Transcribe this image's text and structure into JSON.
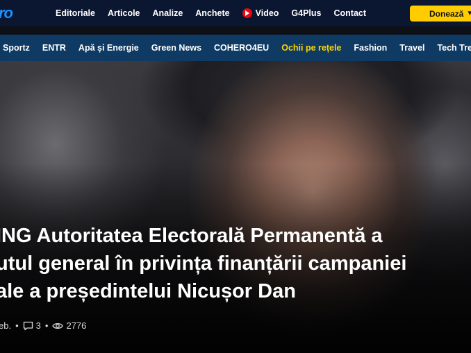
{
  "brand": {
    "logo_text": "ro"
  },
  "top_nav": {
    "items": [
      "Editoriale",
      "Articole",
      "Analize",
      "Anchete",
      "Video",
      "G4Plus",
      "Contact"
    ],
    "donate_label": "Donează",
    "accent_color": "#ffcc00"
  },
  "section_nav": {
    "items": [
      "Sportz",
      "ENTR",
      "Apă și Energie",
      "Green News",
      "COHERO4EU",
      "Ochii pe rețele",
      "Fashion",
      "Travel",
      "Tech Trends"
    ],
    "highlight_color": "#ffd400"
  },
  "article": {
    "headline_lines": [
      "ING Autoritatea Electorală Permanentă a",
      "utul general în privința finanțării campaniei",
      "ale a președintelui Nicușor Dan"
    ],
    "date": "eb.",
    "comments": "3",
    "views": "2776"
  },
  "icons": [
    "play-icon",
    "caret-down-icon",
    "comment-icon",
    "eye-icon"
  ]
}
